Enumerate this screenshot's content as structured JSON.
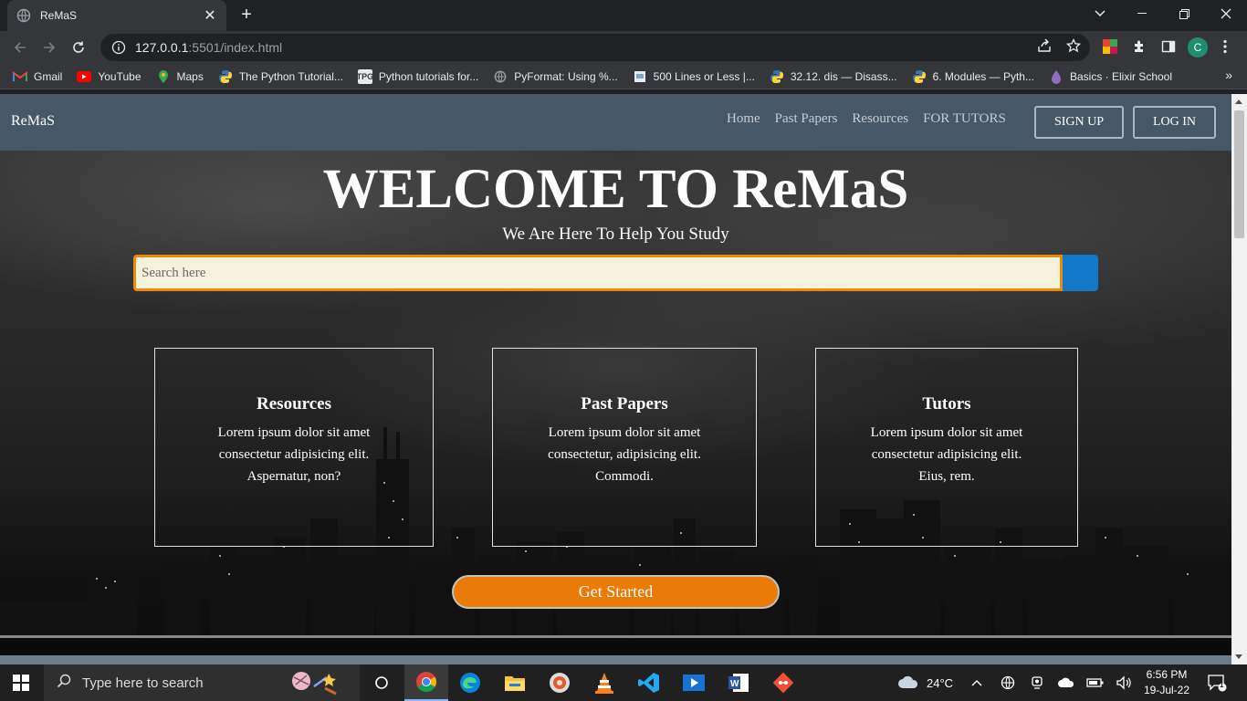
{
  "browser": {
    "tab_title": "ReMaS",
    "url_host": "127.0.0.1",
    "url_rest": ":5501/index.html",
    "profile_initial": "C",
    "bookmarks": [
      {
        "label": "Gmail",
        "icon": "gmail-icon"
      },
      {
        "label": "YouTube",
        "icon": "youtube-icon"
      },
      {
        "label": "Maps",
        "icon": "maps-icon"
      },
      {
        "label": "The Python Tutorial...",
        "icon": "python-icon"
      },
      {
        "label": "Python tutorials for...",
        "icon": "tpg-icon"
      },
      {
        "label": "PyFormat: Using %...",
        "icon": "globe-icon"
      },
      {
        "label": "500 Lines or Less |...",
        "icon": "page-icon"
      },
      {
        "label": "32.12. dis — Disass...",
        "icon": "python-icon"
      },
      {
        "label": "6. Modules — Pyth...",
        "icon": "python-icon"
      },
      {
        "label": "Basics · Elixir School",
        "icon": "elixir-icon"
      }
    ],
    "tpg_text": "TPG"
  },
  "site": {
    "brand": "ReMaS",
    "nav": [
      "Home",
      "Past Papers",
      "Resources",
      "FOR TUTORS"
    ],
    "signup_label": "SIGN UP",
    "login_label": "LOG IN",
    "hero_title": "WELCOME TO ReMaS",
    "hero_subtitle": "We Are Here To Help You Study",
    "search_placeholder": "Search here",
    "cards": [
      {
        "title": "Resources",
        "text": "Lorem ipsum dolor sit amet consectetur adipisicing elit. Aspernatur, non?"
      },
      {
        "title": "Past Papers",
        "text": "Lorem ipsum dolor sit amet consectetur, adipisicing elit. Commodi."
      },
      {
        "title": "Tutors",
        "text": "Lorem ipsum dolor sit amet consectetur adipisicing elit. Eius, rem."
      }
    ],
    "cta_label": "Get Started"
  },
  "taskbar": {
    "search_placeholder": "Type here to search",
    "weather": "24°C",
    "time": "6:56 PM",
    "date": "19-Jul-22",
    "notification_count": "1"
  },
  "colors": {
    "navbar": "#475766",
    "accent_orange": "#ea7b07",
    "search_button": "#1378c7",
    "search_bg": "#f5f2dc"
  }
}
